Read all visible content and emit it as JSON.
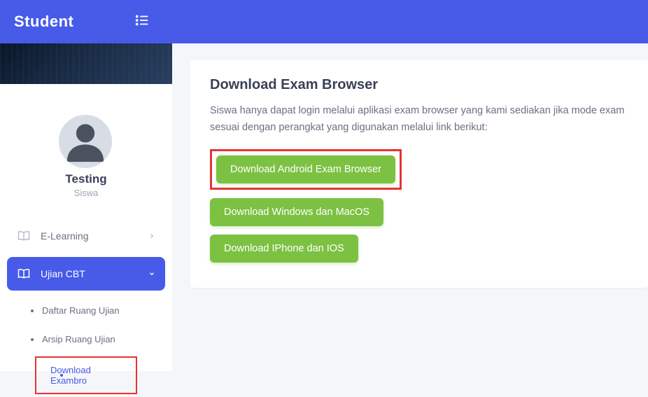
{
  "header": {
    "brand": "Student"
  },
  "profile": {
    "name": "Testing",
    "role": "Siswa"
  },
  "nav": {
    "elearning": "E-Learning",
    "ujian_cbt": "Ujian CBT",
    "sub": {
      "daftar": "Daftar Ruang Ujian",
      "arsip": "Arsip Ruang Ujian",
      "download": "Download Exambro"
    }
  },
  "main": {
    "title": "Download Exam Browser",
    "desc": "Siswa hanya dapat login melalui aplikasi exam browser yang kami sediakan jika mode exam sesuai dengan perangkat yang digunakan melalui link berikut:",
    "btn_android": "Download Android Exam Browser",
    "btn_windows": "Download Windows dan MacOS",
    "btn_ios": "Download IPhone dan IOS"
  }
}
